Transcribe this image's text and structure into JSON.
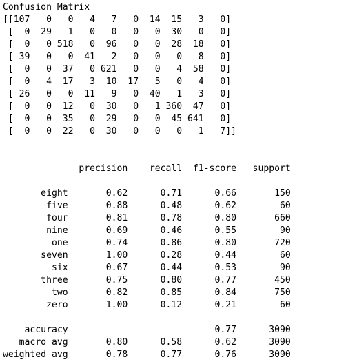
{
  "output": {
    "lines": [
      "Confusion Matrix",
      "[[107   0   0   4   7   0  14  15   3   0]",
      " [  0  29   1   0   0   0   0  30   0   0]",
      " [  0   0 518   0  96   0   0  28  18   0]",
      " [ 39   0   0  41   2   0   0   0   8   0]",
      " [  0   0  37   0 621   0   0   4  58   0]",
      " [  0   4  17   3  10  17   5   0   4   0]",
      " [ 26   0   0  11   9   0  40   1   3   0]",
      " [  0   0  12   0  30   0   1 360  47   0]",
      " [  0   0  35   0  29   0   0  45 641   0]",
      " [  0   0  22   0  30   0   0   0   1   7]]",
      "",
      "",
      "              precision    recall  f1-score   support",
      "",
      "       eight       0.62      0.71      0.66       150",
      "        five       0.88      0.48      0.62        60",
      "        four       0.81      0.78      0.80       660",
      "        nine       0.69      0.46      0.55        90",
      "         one       0.74      0.86      0.80       720",
      "       seven       1.00      0.28      0.44        60",
      "         six       0.67      0.44      0.53        90",
      "       three       0.75      0.80      0.77       450",
      "         two       0.82      0.85      0.84       750",
      "        zero       1.00      0.12      0.21        60",
      "",
      "    accuracy                           0.77      3090",
      "   macro avg       0.80      0.58      0.62      3090",
      "weighted avg       0.78      0.77      0.76      3090"
    ]
  }
}
